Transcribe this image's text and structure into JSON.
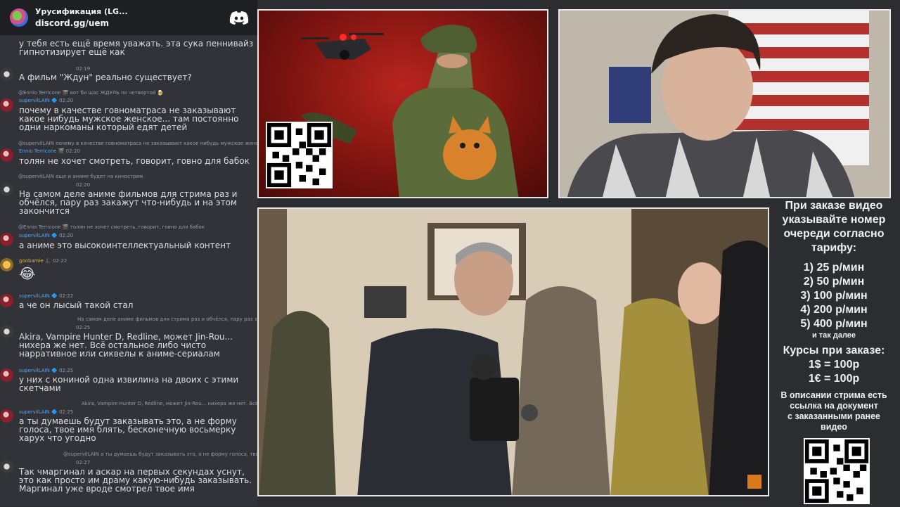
{
  "chat": {
    "server_name": "Урусификация (LG...",
    "server_invite": "discord.gg/uem",
    "messages": [
      {
        "text": "у тебя есть ещё время уважать. эта сука пеннивайз гипнотизирует ещё как"
      },
      {
        "time": "02:19",
        "text": "А фильм \"Ждун\" реально существует?"
      },
      {
        "reply": "@Ennio Terricone 🎬 вот би щас ЖДУЛЬ по четвертой 🍺",
        "user": "supervilLAIN",
        "time": "02:20",
        "text": "почему в качестве говноматраса не заказывают какое нибудь мужское женское... там постоянно одни наркоманы который едят детей"
      },
      {
        "reply": "@supervilLAIN почему в качестве говноматраса не заказывают какое нибудь мужское женское...",
        "user": "Ennio Terricone",
        "time": "02:20",
        "text": "толян не хочет смотреть, говорит, говно для бабок"
      },
      {
        "reply": "@supervilLAIN еще и аниме будет на кинострим",
        "time": "02:20",
        "text": "На самом деле аниме фильмов для стрима раз и обчёлся, пару раз закажут что-нибудь и на этом закончится"
      },
      {
        "reply": "@Ennio Terricone 🎬 толян не хочет смотреть, говорит, говно для бабок",
        "user": "supervilLAIN",
        "time": "02:20",
        "text": "а аниме это высокоинтеллектуальный контент"
      },
      {
        "user": "goobamie",
        "time": "02:22",
        "text": "😂"
      },
      {
        "user": "supervilLAIN",
        "time": "02:22",
        "text": "а че он лысый такой стал"
      },
      {
        "reply": "На самом деле аниме фильмов для стрима раз и обчёлся, пару раз закажут...",
        "time": "02:25",
        "text": "Akira, Vampire Hunter D, Redline, может Jin-Rou... нихера же нет. Всё остальное либо чисто нарративное или сиквелы к аниме-сериалам"
      },
      {
        "user": "supervilLAIN",
        "time": "02:25",
        "text": "у них с кониной одна извилина на двоих с этими скетчами"
      },
      {
        "reply": "Akira, Vampire Hunter D, Redline, может Jin-Rou... нихера же нет. Всё остан",
        "user": "supervilLAIN",
        "time": "02:25",
        "text": "а ты думаешь будут заказывать это, а не форму голоса, твое имя блять, бесконечную восьмерку харух что угодно"
      },
      {
        "reply": "@supervilLAIN а ты думаешь будут заказывать это, а не форму голоса, твое имя блять, бесконечн",
        "time": "02:27",
        "text": "Так чмаргинал и аскар на первых секундах уснут, это как просто им драму какую-нибудь заказывать. Маргинал уже вроде смотрел твое имя"
      }
    ]
  },
  "info": {
    "header": [
      "При заказе видео",
      "указывайте номер",
      "очереди согласно",
      "тарифу:"
    ],
    "tariffs": [
      "1) 25 р/мин",
      "2) 50 р/мин",
      "3) 100 р/мин",
      "4) 200 р/мин",
      "5) 400 р/мин"
    ],
    "tariffs_more": "и так далее",
    "rates_title": "Курсы при заказе:",
    "rates": [
      "1$ = 100р",
      "1€ = 100р"
    ],
    "note": [
      "В описании стрима есть",
      "ссылка на документ",
      "с заказанными ранее",
      "видео"
    ]
  },
  "colors": {
    "background": "#2b2d31",
    "chat": "#313338",
    "header": "#1e1f22",
    "username": "#5aa5f0"
  }
}
